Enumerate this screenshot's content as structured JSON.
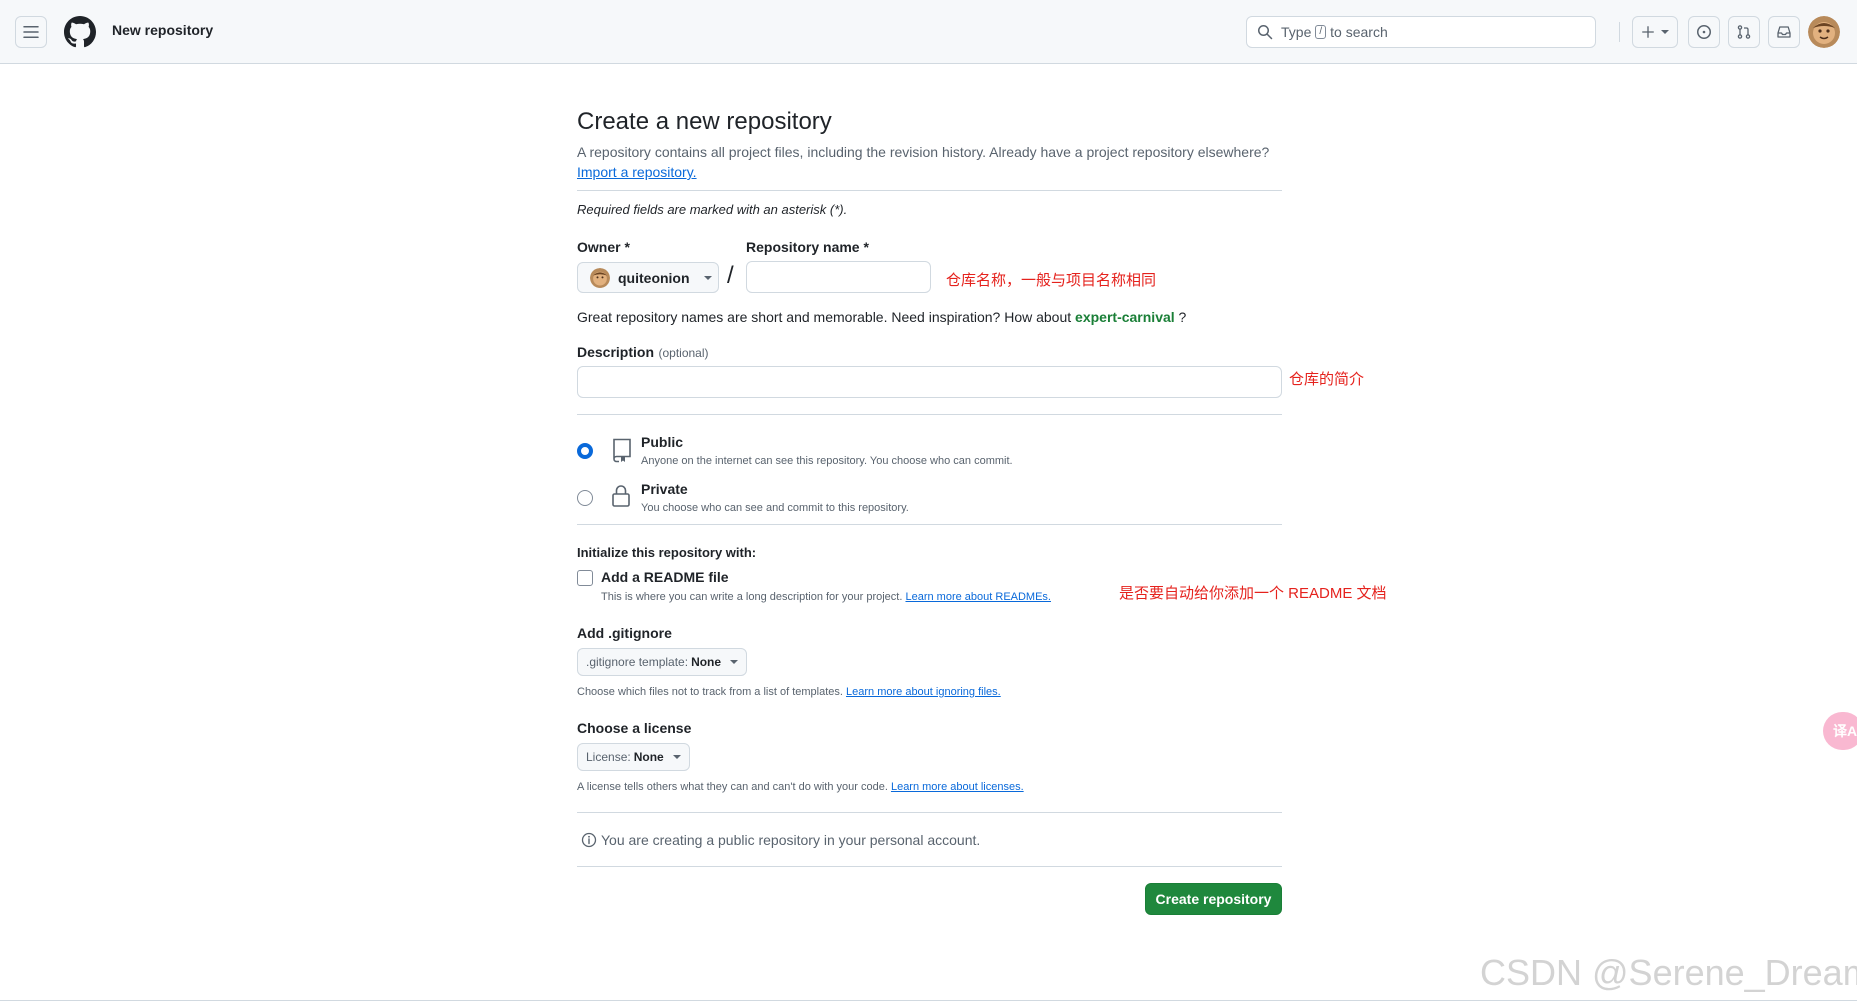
{
  "header": {
    "title": "New repository",
    "search_prefix": "Type",
    "search_key": "/",
    "search_suffix": "to search",
    "create_icon": "plus-icon",
    "issues_icon": "issue-opened-icon",
    "pulls_icon": "git-pull-request-icon",
    "inbox_icon": "inbox-icon"
  },
  "page": {
    "title": "Create a new repository",
    "subtitle": "A repository contains all project files, including the revision history. Already have a project repository elsewhere?",
    "import_link": "Import a repository.",
    "required_note": "Required fields are marked with an asterisk (*)."
  },
  "owner": {
    "label": "Owner *",
    "value": "quiteonion"
  },
  "repo_name": {
    "label": "Repository name *",
    "value": "",
    "separator": "/"
  },
  "name_hint": {
    "text": "Great repository names are short and memorable. Need inspiration? How about",
    "suggestion": "expert-carnival",
    "suffix": "?"
  },
  "description": {
    "label": "Description",
    "optional": "(optional)",
    "value": ""
  },
  "visibility": {
    "selected": "public",
    "public": {
      "title": "Public",
      "desc": "Anyone on the internet can see this repository. You choose who can commit."
    },
    "private": {
      "title": "Private",
      "desc": "You choose who can see and commit to this repository."
    }
  },
  "init": {
    "heading": "Initialize this repository with:",
    "readme_label": "Add a README file",
    "readme_checked": false,
    "readme_desc": "This is where you can write a long description for your project.",
    "readme_link": "Learn more about READMEs."
  },
  "gitignore": {
    "heading": "Add .gitignore",
    "select_prefix": ".gitignore template:",
    "select_value": "None",
    "help": "Choose which files not to track from a list of templates.",
    "help_link": "Learn more about ignoring files."
  },
  "license": {
    "heading": "Choose a license",
    "select_prefix": "License:",
    "select_value": "None",
    "help": "A license tells others what they can and can't do with your code.",
    "help_link": "Learn more about licenses."
  },
  "info_note": "You are creating a public repository in your personal account.",
  "create_button": "Create repository",
  "annotations": {
    "repo_name": "仓库名称，一般与项目名称相同",
    "description": "仓库的简介",
    "readme": "是否要自动给你添加一个 README 文档"
  },
  "translate_tab": "译A",
  "watermark": "CSDN @Serene_Dream",
  "colors": {
    "accent_blue": "#0969da",
    "primary_green": "#1f883d",
    "annotation_red": "#e5221d",
    "suggestion_green": "#1a7f37"
  }
}
